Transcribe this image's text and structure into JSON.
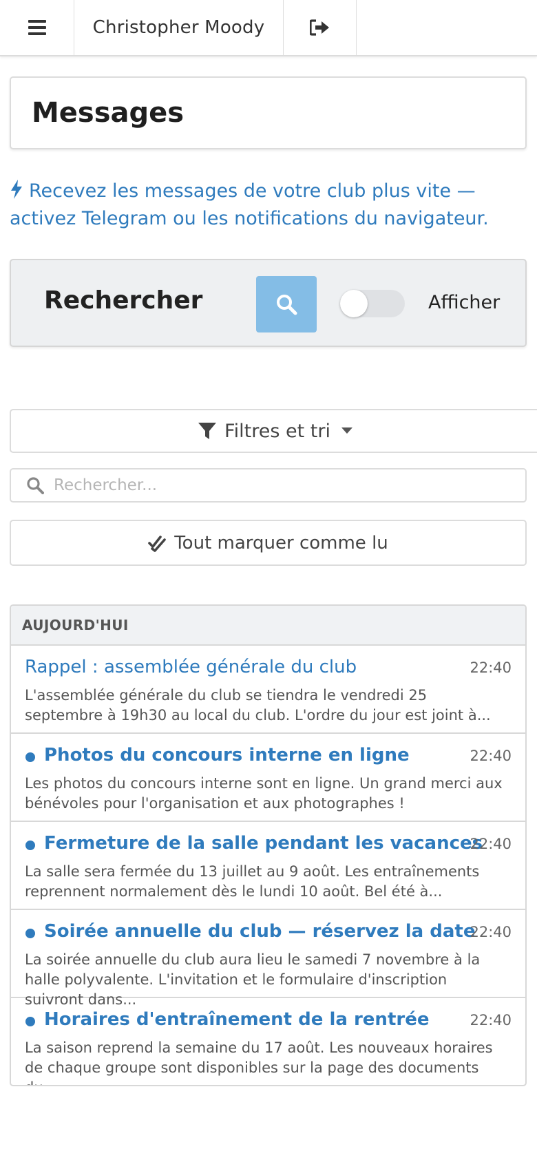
{
  "nav": {
    "user_name": "Christopher Moody"
  },
  "page": {
    "title": "Messages"
  },
  "promo": {
    "text": "Recevez les messages de votre club plus vite — activez Telegram ou les notifications du navigateur."
  },
  "search_panel": {
    "title": "Rechercher",
    "toggle_label": "Afficher",
    "toggle_on": false
  },
  "filters": {
    "label": "Filtres et tri"
  },
  "search": {
    "placeholder": "Rechercher...",
    "value": ""
  },
  "mark_all": {
    "label": "Tout marquer comme lu"
  },
  "messages": {
    "group_label": "AUJOURD'HUI",
    "items": [
      {
        "title": "Rappel : assemblée générale du club",
        "time": "22:40",
        "snippet": "L'assemblée générale du club se tiendra le vendredi 25 septembre à 19h30 au local du club. L'ordre du jour est joint à...",
        "unread": false
      },
      {
        "title": "Photos du concours interne en ligne",
        "time": "22:40",
        "snippet": "Les photos du concours interne sont en ligne. Un grand merci aux bénévoles pour l'organisation et aux photographes !",
        "unread": true
      },
      {
        "title": "Fermeture de la salle pendant les vacances",
        "time": "22:40",
        "snippet": "La salle sera fermée du 13 juillet au 9 août. Les entraînements reprennent normalement dès le lundi 10 août. Bel été à...",
        "unread": true
      },
      {
        "title": "Soirée annuelle du club — réservez la date",
        "time": "22:40",
        "snippet": "La soirée annuelle du club aura lieu le samedi 7 novembre à la halle polyvalente. L'invitation et le formulaire d'inscription suivront dans...",
        "unread": true
      },
      {
        "title": "Horaires d'entraînement de la rentrée",
        "time": "22:40",
        "snippet": "La saison reprend la semaine du 17 août. Les nouveaux horaires de chaque groupe sont disponibles sur la page des documents du...",
        "unread": true
      }
    ]
  },
  "colors": {
    "link": "#2f7bbd",
    "search_button": "#84bde6",
    "panel_bg": "#eef0f2"
  },
  "icons": {
    "menu": "bars-icon",
    "logout": "sign-out-icon",
    "promo": "bolt-icon",
    "search_button": "search-icon",
    "filters": "filter-icon",
    "filters_caret": "caret-down-icon",
    "search_field": "search-icon",
    "mark_all": "double-check-icon"
  }
}
